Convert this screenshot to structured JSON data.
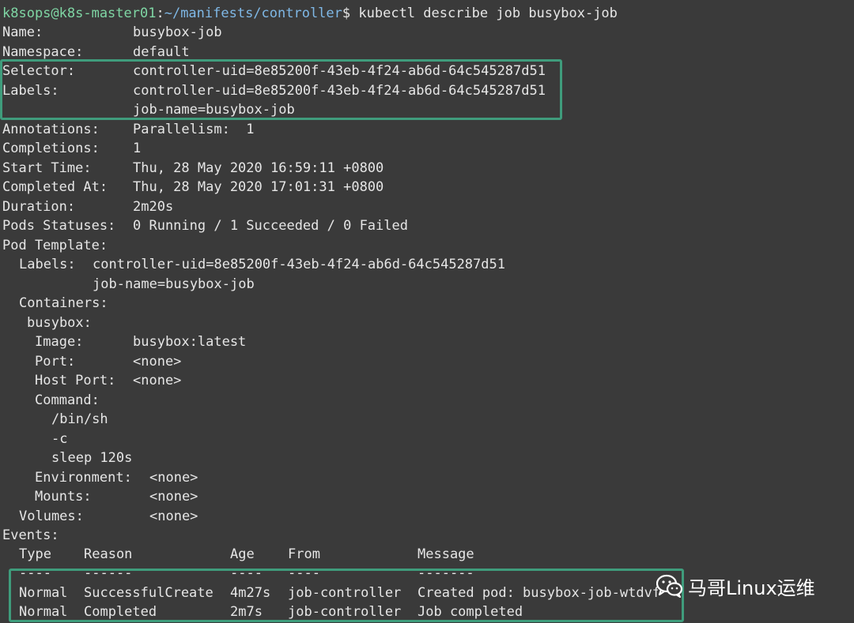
{
  "prompt": {
    "user_host": "k8sops@k8s-master01",
    "sep": ":",
    "path": "~/manifests/controller",
    "dollar": "$",
    "command": "kubectl describe job busybox-job"
  },
  "fields": {
    "name_label": "Name:",
    "name_value": "busybox-job",
    "namespace_label": "Namespace:",
    "namespace_value": "default",
    "selector_label": "Selector:",
    "selector_value": "controller-uid=8e85200f-43eb-4f24-ab6d-64c545287d51",
    "labels_label": "Labels:",
    "labels_value_1": "controller-uid=8e85200f-43eb-4f24-ab6d-64c545287d51",
    "labels_value_2": "job-name=busybox-job",
    "annotations_label": "Annotations:",
    "annotations_value": "Parallelism:  1",
    "completions_label": "Completions:",
    "completions_value": "1",
    "start_label": "Start Time:",
    "start_value": "Thu, 28 May 2020 16:59:11 +0800",
    "completed_label": "Completed At:",
    "completed_value": "Thu, 28 May 2020 17:01:31 +0800",
    "duration_label": "Duration:",
    "duration_value": "2m20s",
    "pods_label": "Pods Statuses:",
    "pods_value": "0 Running / 1 Succeeded / 0 Failed",
    "pod_template_label": "Pod Template:"
  },
  "template": {
    "labels_label": "Labels:",
    "labels_value_1": "controller-uid=8e85200f-43eb-4f24-ab6d-64c545287d51",
    "labels_value_2": "job-name=busybox-job",
    "containers_label": "Containers:",
    "container_name": "busybox:",
    "image_label": "Image:",
    "image_value": "busybox:latest",
    "port_label": "Port:",
    "port_value": "<none>",
    "hostport_label": "Host Port:",
    "hostport_value": "<none>",
    "command_label": "Command:",
    "cmd_1": "/bin/sh",
    "cmd_2": "-c",
    "cmd_3": "sleep 120s",
    "env_label": "Environment:",
    "env_value": "<none>",
    "mounts_label": "Mounts:",
    "mounts_value": "<none>",
    "volumes_label": "Volumes:",
    "volumes_value": "<none>"
  },
  "events": {
    "label": "Events:",
    "headers": [
      "Type",
      "Reason",
      "Age",
      "From",
      "Message"
    ],
    "dashes": [
      "----",
      "------",
      "----",
      "----",
      "-------"
    ],
    "rows": [
      [
        "Normal",
        "SuccessfulCreate",
        "4m27s",
        "job-controller",
        "Created pod: busybox-job-wtdvf"
      ],
      [
        "Normal",
        "Completed",
        "2m7s",
        "job-controller",
        "Job completed"
      ]
    ]
  },
  "watermark": {
    "text": "马哥Linux运维",
    "icon": "wechat-icon"
  },
  "colors": {
    "background": "#3a3a3a",
    "text": "#e6e6e6",
    "highlight_border": "#3f9c7c"
  }
}
